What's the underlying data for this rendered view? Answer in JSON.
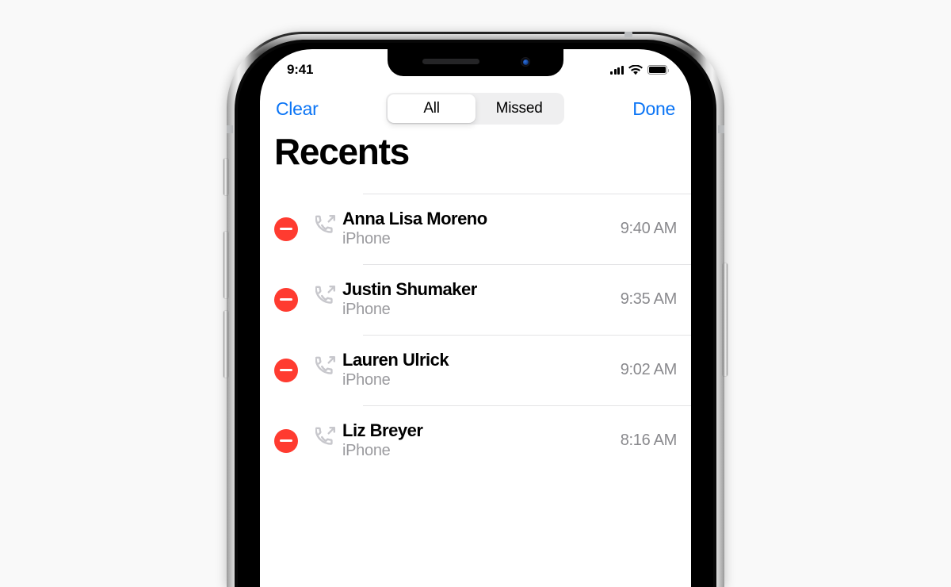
{
  "background_color": "#F9F9F9",
  "device": {
    "name": "iPhone X",
    "frame_color": "#222222",
    "antenna_color": "#B9BBBD",
    "buttons": [
      {
        "name": "ring-silent-switch"
      },
      {
        "name": "volume-up-button"
      },
      {
        "name": "volume-down-button"
      },
      {
        "name": "side-power-button"
      }
    ],
    "notch": {
      "speaker_grille": "earpiece-speaker",
      "front_camera": "front-camera"
    }
  },
  "status_bar": {
    "time": "9:41",
    "cellular_icon": "signal-bars-icon",
    "signal_bars": 4,
    "wifi_icon": "wifi-icon",
    "battery_icon": "battery-icon",
    "battery_full": true
  },
  "nav_bar": {
    "left_button": "Clear",
    "right_button": "Done",
    "accent_color": "#0A74F5",
    "segmented_control": {
      "options": [
        "All",
        "Missed"
      ],
      "selected": "All",
      "track_color": "#EFEFF0"
    }
  },
  "page_title": "Recents",
  "list": {
    "delete_color": "#FF3B30",
    "separator_color": "#E3E3E5",
    "rows": [
      {
        "delete_label": "Delete",
        "call_type_icon": "outgoing-call-icon",
        "name": "Anna Lisa Moreno",
        "label": "iPhone",
        "time": "9:40 AM"
      },
      {
        "delete_label": "Delete",
        "call_type_icon": "outgoing-call-icon",
        "name": "Justin Shumaker",
        "label": "iPhone",
        "time": "9:35 AM"
      },
      {
        "delete_label": "Delete",
        "call_type_icon": "outgoing-call-icon",
        "name": "Lauren Ulrick",
        "label": "iPhone",
        "time": "9:02 AM"
      },
      {
        "delete_label": "Delete",
        "call_type_icon": "outgoing-call-icon",
        "name": "Liz Breyer",
        "label": "iPhone",
        "time": "8:16 AM"
      }
    ]
  }
}
